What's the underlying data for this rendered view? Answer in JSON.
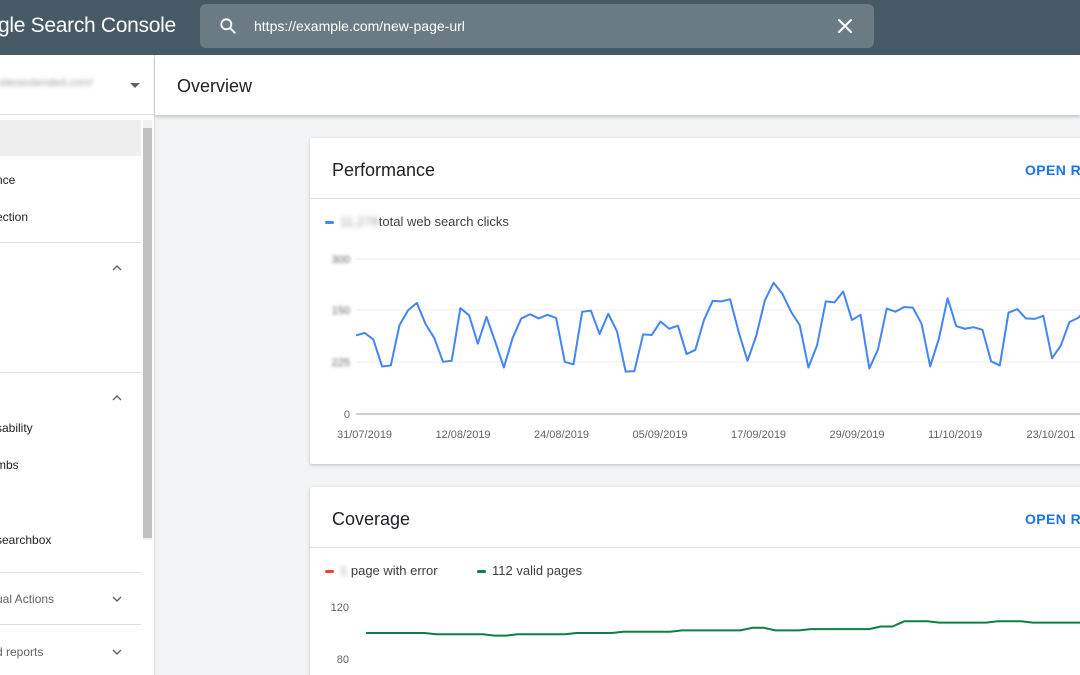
{
  "topbar": {
    "brand": "gle Search Console",
    "search_value": "https://example.com/new-page-url"
  },
  "sidebar": {
    "property_url": "sitesextended.com/",
    "items": [
      {
        "label": "",
        "active": true
      },
      {
        "label": "nce"
      },
      {
        "label": "ection"
      }
    ],
    "enhancements": [
      {
        "label": "sability"
      },
      {
        "label": "mbs"
      },
      {
        "label": "searchbox"
      }
    ],
    "sections": [
      {
        "label": "ual Actions"
      },
      {
        "label": "d reports"
      }
    ]
  },
  "header": {
    "title": "Overview"
  },
  "performance": {
    "title": "Performance",
    "open_report": "OPEN RE",
    "legend_count": "11,278",
    "legend_text": "total web search clicks",
    "color": "#4285f4",
    "chart_data": {
      "type": "line",
      "x_labels": [
        "31/07/2019",
        "12/08/2019",
        "24/08/2019",
        "05/09/2019",
        "17/09/2019",
        "29/09/2019",
        "11/10/2019",
        "23/10/201"
      ],
      "y_ticks": [
        "300",
        "150",
        "225",
        "0"
      ],
      "ylim": [
        0,
        300
      ],
      "series": [
        {
          "values": [
            152,
            157,
            144,
            92,
            94,
            172,
            201,
            215,
            174,
            147,
            101,
            103,
            205,
            191,
            136,
            188,
            140,
            90,
            147,
            185,
            193,
            185,
            192,
            186,
            101,
            96,
            198,
            200,
            155,
            194,
            160,
            82,
            83,
            154,
            153,
            179,
            165,
            171,
            116,
            124,
            182,
            219,
            218,
            222,
            158,
            103,
            151,
            220,
            254,
            233,
            198,
            172,
            90,
            133,
            218,
            216,
            237,
            182,
            192,
            88,
            125,
            204,
            198,
            207,
            206,
            175,
            92,
            146,
            224,
            170,
            165,
            168,
            163,
            102,
            94,
            196,
            203,
            185,
            184,
            190,
            108,
            132,
            178,
            186,
            203,
            203,
            113
          ]
        }
      ]
    }
  },
  "coverage": {
    "title": "Coverage",
    "open_report": "OPEN RE",
    "legend_error_count": "1",
    "legend_error_text": "page with error",
    "legend_valid_text": "112 valid pages",
    "error_color": "#ea4335",
    "valid_color": "#0b8043",
    "chart_data": {
      "type": "line",
      "y_ticks": [
        "120",
        "80"
      ],
      "series": [
        {
          "name": "112 valid pages",
          "values": [
            100,
            100,
            100,
            100,
            100,
            100,
            99,
            99,
            99,
            99,
            99,
            98,
            98,
            99,
            99,
            99,
            99,
            99,
            100,
            100,
            100,
            100,
            101,
            101,
            101,
            101,
            101,
            102,
            102,
            102,
            102,
            102,
            102,
            104,
            104,
            102,
            102,
            102,
            103,
            103,
            103,
            103,
            103,
            103,
            105,
            105,
            109,
            109,
            109,
            108,
            108,
            108,
            108,
            108,
            109,
            109,
            109,
            108,
            108,
            108,
            108,
            108,
            111,
            111,
            112
          ]
        }
      ]
    }
  }
}
